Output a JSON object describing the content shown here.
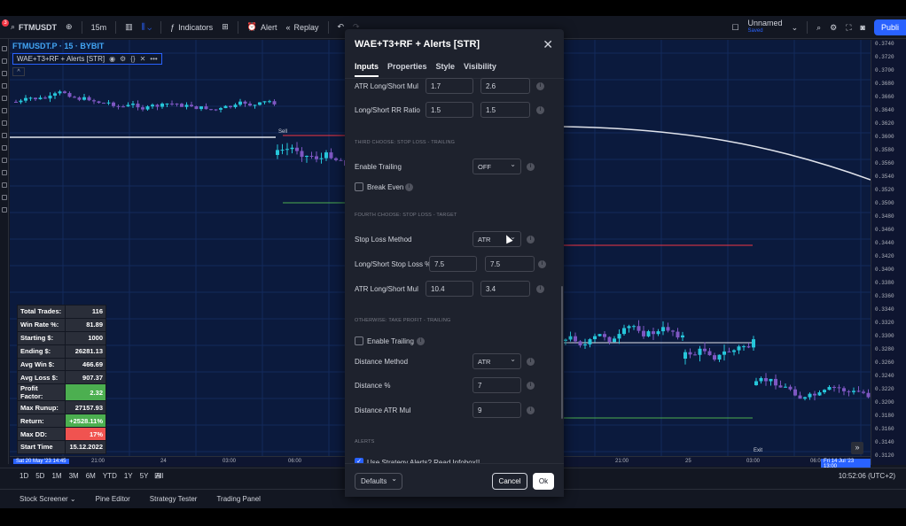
{
  "toolbar": {
    "notification_count": "3",
    "symbol": "FTMUSDT",
    "interval": "15m",
    "indicators": "Indicators",
    "alert": "Alert",
    "replay": "Replay",
    "layout_name": "Unnamed",
    "layout_status": "Saved",
    "publish": "Publi"
  },
  "legend": {
    "symbol_line": "FTMUSDT.P · 15 · BYBIT",
    "indicator": "WAE+T3+RF + Alerts [STR]",
    "caret": "^"
  },
  "chart_labels": {
    "sell": "Sell",
    "exit": "Exit"
  },
  "price_axis": [
    "0.3740",
    "0.3720",
    "0.3700",
    "0.3680",
    "0.3660",
    "0.3640",
    "0.3620",
    "0.3600",
    "0.3580",
    "0.3560",
    "0.3540",
    "0.3520",
    "0.3500",
    "0.3480",
    "0.3460",
    "0.3440",
    "0.3420",
    "0.3400",
    "0.3380",
    "0.3360",
    "0.3340",
    "0.3320",
    "0.3300",
    "0.3280",
    "0.3260",
    "0.3240",
    "0.3220",
    "0.3200",
    "0.3180",
    "0.3160",
    "0.3140",
    "0.3120"
  ],
  "time_axis": {
    "start_tag": "Sat 20 May '23  14:45",
    "ticks": [
      "21:00",
      "24",
      "03:00",
      "06:00",
      "21:00",
      "25",
      "03:00",
      "06:0"
    ],
    "end_tag": "Fri 14 Jul '23  13:00"
  },
  "stats": [
    {
      "k": "Total Trades:",
      "v": "116",
      "style": ""
    },
    {
      "k": "Win Rate %:",
      "v": "81.89",
      "style": ""
    },
    {
      "k": "Starting $:",
      "v": "1000",
      "style": ""
    },
    {
      "k": "Ending $:",
      "v": "26281.13",
      "style": ""
    },
    {
      "k": "Avg Win $:",
      "v": "466.69",
      "style": ""
    },
    {
      "k": "Avg Loss $:",
      "v": "907.37",
      "style": ""
    },
    {
      "k": "Profit Factor:",
      "v": "2.32",
      "style": "green"
    },
    {
      "k": "Max Runup:",
      "v": "27157.93",
      "style": ""
    },
    {
      "k": "Return:",
      "v": "+2528.11%",
      "style": "green"
    },
    {
      "k": "Max DD:",
      "v": "17%",
      "style": "red"
    },
    {
      "k": "Start Time",
      "v": "15.12.2022",
      "style": ""
    }
  ],
  "timeframes": [
    "1D",
    "5D",
    "1M",
    "3M",
    "6M",
    "YTD",
    "1Y",
    "5Y",
    "All"
  ],
  "clock": "10:52:06 (UTC+2)",
  "bottom_tabs": [
    "Stock Screener",
    "Pine Editor",
    "Strategy Tester",
    "Trading Panel"
  ],
  "dialog": {
    "title": "WAE+T3+RF + Alerts [STR]",
    "close": "✕",
    "tabs": [
      "Inputs",
      "Properties",
      "Style",
      "Visibility"
    ],
    "atr_ls_mul_1": {
      "label": "ATR Long/Short Mul",
      "v1": "1.7",
      "v2": "2.6"
    },
    "rr": {
      "label": "Long/Short RR Ratio",
      "v1": "1.5",
      "v2": "1.5"
    },
    "sec_third": "THIRD CHOOSE: STOP LOSS - TRAILING",
    "enable_trailing": {
      "label": "Enable Trailing",
      "value": "OFF"
    },
    "break_even": "Break Even",
    "sec_fourth": "FOURTH CHOOSE: STOP LOSS - TARGET",
    "sl_method": {
      "label": "Stop Loss Method",
      "value": "ATR"
    },
    "sl_pct": {
      "label": "Long/Short Stop Loss %",
      "v1": "7.5",
      "v2": "7.5"
    },
    "atr_ls_mul_2": {
      "label": "ATR Long/Short Mul",
      "v1": "10.4",
      "v2": "3.4"
    },
    "sec_otherwise": "OTHERWISE: TAKE PROFIT - TRAILING",
    "enable_trailing_tp": "Enable Trailing",
    "distance_method": {
      "label": "Distance Method",
      "value": "ATR"
    },
    "distance_pct": {
      "label": "Distance %",
      "value": "7"
    },
    "distance_atr": {
      "label": "Distance ATR Mul",
      "value": "9"
    },
    "sec_alerts": "ALERTS",
    "use_alerts": "Use Strategy Alerts? Read Infobox!!",
    "defaults": "Defaults",
    "cancel": "Cancel",
    "ok": "Ok"
  },
  "colors": {
    "bull": "#26c6da",
    "bear": "#7e57c2",
    "bg": "#0b1a3d",
    "accent": "#2962ff"
  }
}
